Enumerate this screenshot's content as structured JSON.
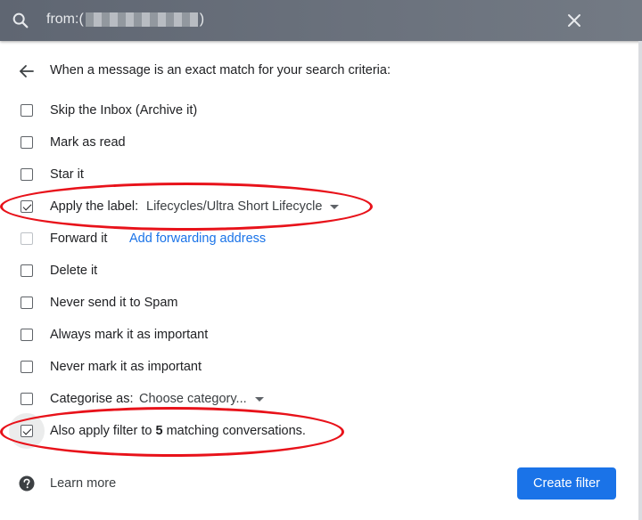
{
  "search": {
    "prefix": "from:(",
    "suffix": ")",
    "icon": "search-icon",
    "close_icon": "close-icon"
  },
  "header": {
    "back_icon": "arrow-back-icon",
    "text": "When a message is an exact match for your search criteria:"
  },
  "options": [
    {
      "label": "Skip the Inbox (Archive it)",
      "checked": false
    },
    {
      "label": "Mark as read",
      "checked": false
    },
    {
      "label": "Star it",
      "checked": false
    },
    {
      "label": "Apply the label:",
      "checked": true,
      "select_value": "Lifecycles/Ultra Short Lifecycle"
    },
    {
      "label": "Forward it",
      "checked": false,
      "disabled": true,
      "link": "Add forwarding address"
    },
    {
      "label": "Delete it",
      "checked": false
    },
    {
      "label": "Never send it to Spam",
      "checked": false
    },
    {
      "label": "Always mark it as important",
      "checked": false
    },
    {
      "label": "Never mark it as important",
      "checked": false
    },
    {
      "label": "Categorise as:",
      "checked": false,
      "select_value": "Choose category..."
    },
    {
      "label_pre": "Also apply filter to ",
      "count": "5",
      "label_post": " matching conversations.",
      "checked": true
    }
  ],
  "footer": {
    "help_icon": "help-icon",
    "learn_more": "Learn more",
    "create_filter": "Create filter"
  },
  "colors": {
    "primary": "#1a73e8",
    "annotation": "#e8121a",
    "search_bar": "#6b727d"
  }
}
